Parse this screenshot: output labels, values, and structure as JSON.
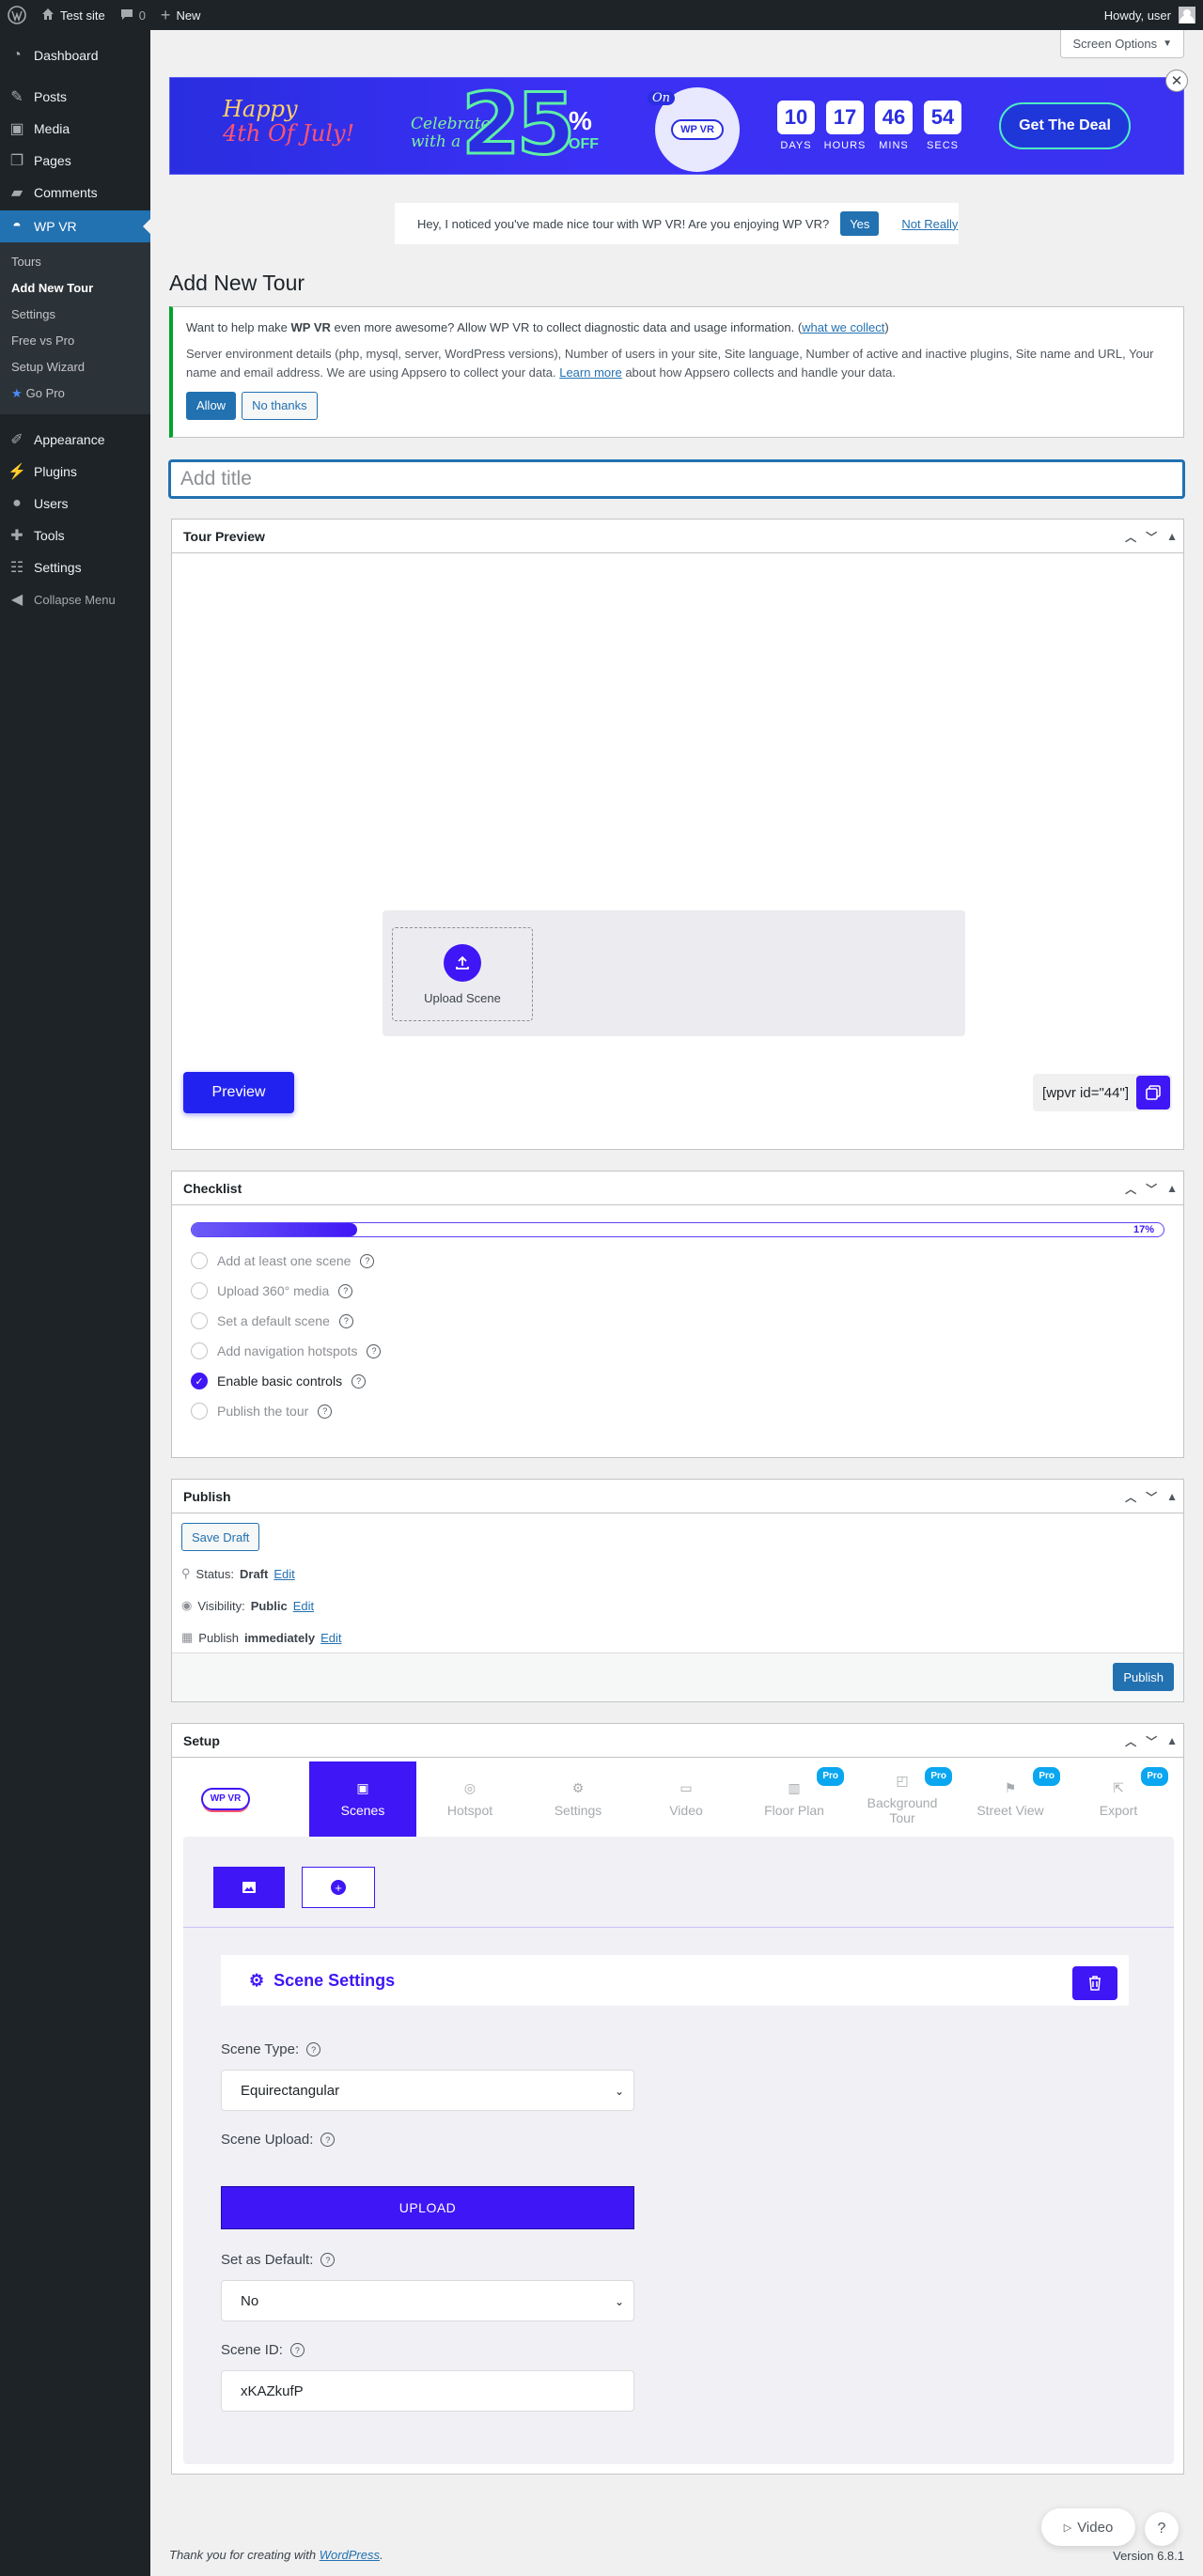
{
  "adminbar": {
    "site": "Test site",
    "comments": "0",
    "new": "New",
    "howdy": "Howdy, user"
  },
  "sidebar": {
    "dashboard": "Dashboard",
    "posts": "Posts",
    "media": "Media",
    "pages": "Pages",
    "comments": "Comments",
    "wpvr": "WP VR",
    "submenu": [
      "Tours",
      "Add New Tour",
      "Settings",
      "Free vs Pro",
      "Setup Wizard"
    ],
    "gopro": "Go Pro",
    "appearance": "Appearance",
    "plugins": "Plugins",
    "users": "Users",
    "tools": "Tools",
    "settings": "Settings",
    "collapse": "Collapse Menu"
  },
  "screen_options": "Screen Options",
  "promo": {
    "happy": "Happy",
    "fourth": "4th Of July!",
    "celebrate": "Celebrate",
    "with_a": "with a",
    "number": "25",
    "percent": "%",
    "off": "OFF",
    "on": "On",
    "logo": "WP VR",
    "countdown": [
      {
        "n": "10",
        "t": "DAYS"
      },
      {
        "n": "17",
        "t": "HOURS"
      },
      {
        "n": "46",
        "t": "MINS"
      },
      {
        "n": "54",
        "t": "SECS"
      }
    ],
    "deal": "Get The Deal"
  },
  "survey": {
    "text": "Hey, I noticed you've made nice tour with WP VR! Are you enjoying WP VR?",
    "yes": "Yes",
    "no": "Not Really"
  },
  "page_title": "Add New Tour",
  "notice": {
    "p1_a": "Want to help make ",
    "p1_b": "WP VR",
    "p1_c": " even more awesome? Allow WP VR to collect diagnostic data and usage information. (",
    "p1_link": "what we collect",
    "p1_d": ")",
    "p2_a": "Server environment details (php, mysql, server, WordPress versions), Number of users in your site, Site language, Number of active and inactive plugins, Site name and URL, Your name and email address. We are using Appsero to collect your data. ",
    "p2_link": "Learn more",
    "p2_b": " about how Appsero collects and handle your data.",
    "allow": "Allow",
    "no_thanks": "No thanks"
  },
  "title_placeholder": "Add title",
  "tour_preview": {
    "heading": "Tour Preview",
    "upload_scene": "Upload Scene",
    "preview": "Preview",
    "shortcode": "[wpvr id=\"44\"]"
  },
  "checklist": {
    "heading": "Checklist",
    "progress": 0.17,
    "progress_label": "17%",
    "items": [
      "Add at least one scene",
      "Upload 360° media",
      "Set a default scene",
      "Add navigation hotspots",
      "Enable basic controls",
      "Publish the tour"
    ],
    "completed": [
      false,
      false,
      false,
      false,
      true,
      false
    ]
  },
  "publish": {
    "heading": "Publish",
    "save_draft": "Save Draft",
    "status_label": "Status:",
    "status": "Draft",
    "visibility_label": "Visibility:",
    "visibility": "Public",
    "publish_label": "Publish",
    "publish_when": "immediately",
    "edit": "Edit",
    "publish_btn": "Publish"
  },
  "setup": {
    "heading": "Setup",
    "logo": "WP VR",
    "tabs": [
      {
        "label": "Scenes",
        "pro": false
      },
      {
        "label": "Hotspot",
        "pro": false
      },
      {
        "label": "Settings",
        "pro": false
      },
      {
        "label": "Video",
        "pro": false
      },
      {
        "label": "Floor Plan",
        "pro": true
      },
      {
        "label": "Background Tour",
        "pro": true
      },
      {
        "label": "Street View",
        "pro": true
      },
      {
        "label": "Export",
        "pro": true
      }
    ],
    "pro_badge": "Pro",
    "scene_settings": "Scene Settings",
    "scene_type_label": "Scene Type:",
    "scene_type": "Equirectangular",
    "scene_upload_label": "Scene Upload:",
    "upload": "UPLOAD",
    "default_label": "Set as Default:",
    "default_value": "No",
    "scene_id_label": "Scene ID:",
    "scene_id": "xKAZkufP"
  },
  "floating": {
    "video": "Video",
    "help": "?"
  },
  "footer": {
    "text": "Thank you for creating with ",
    "link": "WordPress",
    "period": ".",
    "version": "Version 6.8.1"
  },
  "colors": {
    "wp_blue": "#2271b1",
    "wpvr_purple": "#3f16f5",
    "admin_dark": "#1d2327"
  }
}
